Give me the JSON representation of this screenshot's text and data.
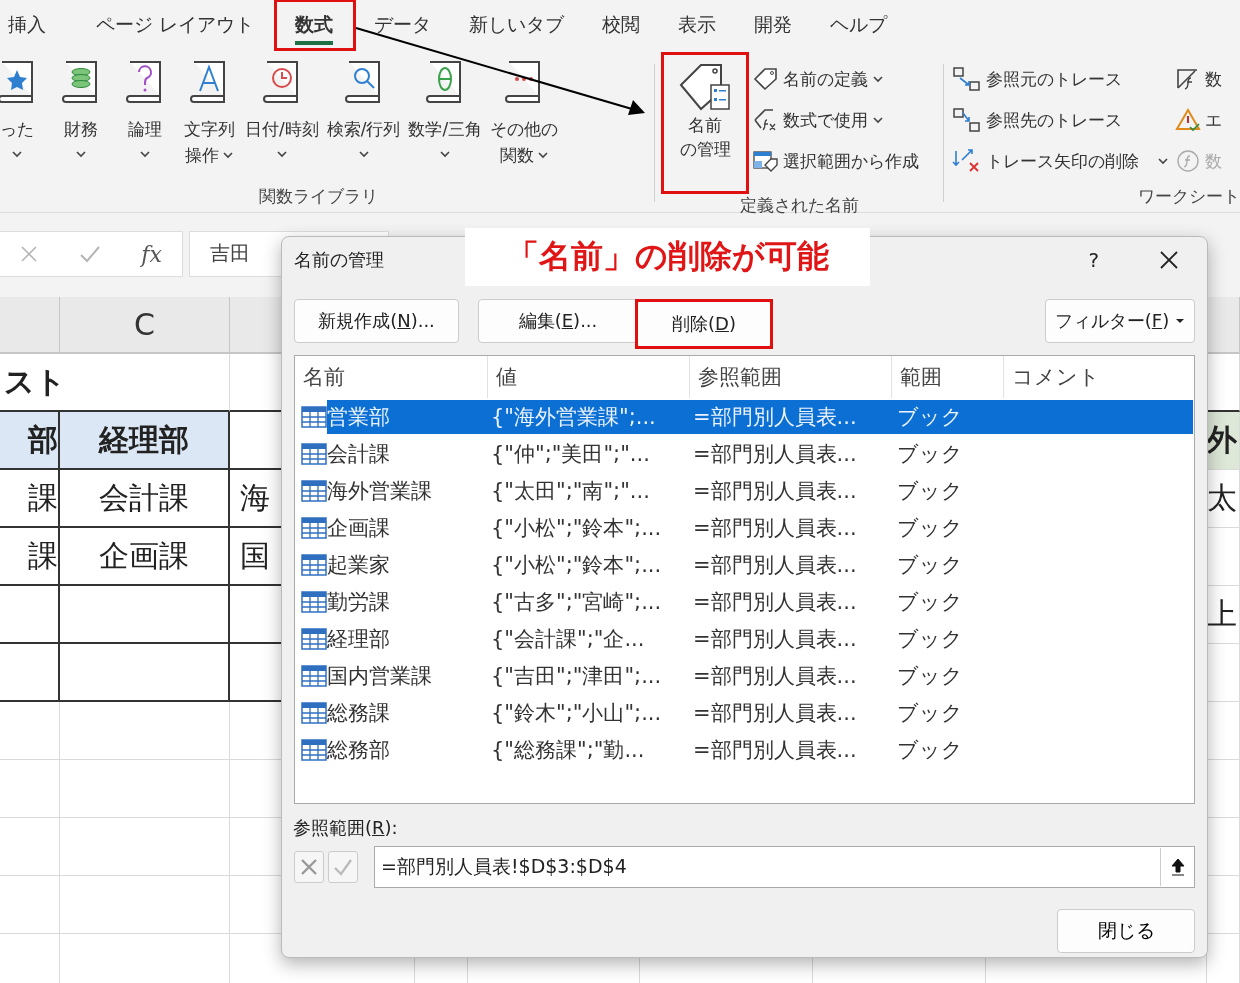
{
  "ribbon_tabs": [
    {
      "label": "挿入",
      "selected": false
    },
    {
      "label": "ページ レイアウト",
      "selected": false
    },
    {
      "label": "数式",
      "selected": true
    },
    {
      "label": "データ",
      "selected": false
    },
    {
      "label": "新しいタブ",
      "selected": false
    },
    {
      "label": "校閲",
      "selected": false
    },
    {
      "label": "表示",
      "selected": false
    },
    {
      "label": "開発",
      "selected": false
    },
    {
      "label": "ヘルプ",
      "selected": false
    }
  ],
  "function_library": {
    "group_label": "関数ライブラリ",
    "buttons": [
      {
        "kind": "recent",
        "lines": [
          "った"
        ]
      },
      {
        "kind": "finance",
        "lines": [
          "財務"
        ]
      },
      {
        "kind": "logic",
        "lines": [
          "論理"
        ]
      },
      {
        "kind": "text",
        "lines": [
          "文字列",
          "操作"
        ]
      },
      {
        "kind": "datetime",
        "lines": [
          "日付/時刻"
        ]
      },
      {
        "kind": "lookup",
        "lines": [
          "検索/行列"
        ]
      },
      {
        "kind": "math",
        "lines": [
          "数学/三角"
        ]
      },
      {
        "kind": "more",
        "lines": [
          "その他の",
          "関数"
        ]
      }
    ]
  },
  "defined_names": {
    "group_label": "定義された名前",
    "manager_lines": [
      "名前",
      "の管理"
    ],
    "commands": [
      {
        "kind": "define",
        "label": "名前の定義",
        "dropdown": true
      },
      {
        "kind": "use",
        "label": "数式で使用",
        "dropdown": true
      },
      {
        "kind": "create",
        "label": "選択範囲から作成",
        "dropdown": false
      }
    ]
  },
  "auditing": {
    "group_label": "ワークシート",
    "commands": [
      {
        "kind": "precedents",
        "label": "参照元のトレース",
        "dropdown": false
      },
      {
        "kind": "dependents",
        "label": "参照先のトレース",
        "dropdown": false
      },
      {
        "kind": "remove",
        "label": "トレース矢印の削除",
        "dropdown": true
      }
    ],
    "cut_commands": [
      {
        "kind": "show",
        "label": "数",
        "disabled": false
      },
      {
        "kind": "error",
        "label": "エ",
        "disabled": false
      },
      {
        "kind": "evaluate",
        "label": "数",
        "disabled": true
      }
    ]
  },
  "formula_bar": {
    "function_symbol": "fx",
    "value": "吉田"
  },
  "sheet": {
    "column_header": "C",
    "rows": [
      {
        "kind": "title",
        "a": "スト"
      },
      {
        "kind": "header",
        "a": "部",
        "c": "経理部",
        "e": "外"
      },
      {
        "kind": "data",
        "a": "課",
        "c": "会計課",
        "d": "海",
        "e": "太"
      },
      {
        "kind": "data",
        "a": "課",
        "c": "企画課",
        "d": "国"
      },
      {
        "kind": "data",
        "e": "上"
      },
      {
        "kind": "data"
      }
    ]
  },
  "dialog": {
    "title": "名前の管理",
    "help": "?",
    "buttons": [
      {
        "before": "新規作成(",
        "key": "N",
        "after": ")...",
        "dropdown": false
      },
      {
        "before": "編集(",
        "key": "E",
        "after": ")...",
        "dropdown": false
      },
      {
        "before": "削除(",
        "key": "D",
        "after": ")",
        "dropdown": false
      },
      {
        "before": "フィルター(",
        "key": "F",
        "after": ")",
        "dropdown": true
      }
    ],
    "columns": [
      "名前",
      "値",
      "参照範囲",
      "範囲",
      "コメント"
    ],
    "rows": [
      {
        "name": "営業部",
        "value": "{\"海外営業課\";...",
        "refers_to": "=部門別人員表...",
        "scope": "ブック",
        "selected": true
      },
      {
        "name": "会計課",
        "value": "{\"仲\";\"美田\";\"...",
        "refers_to": "=部門別人員表...",
        "scope": "ブック",
        "selected": false
      },
      {
        "name": "海外営業課",
        "value": "{\"太田\";\"南\";\"...",
        "refers_to": "=部門別人員表...",
        "scope": "ブック",
        "selected": false
      },
      {
        "name": "企画課",
        "value": "{\"小松\";\"鈴本\";...",
        "refers_to": "=部門別人員表...",
        "scope": "ブック",
        "selected": false
      },
      {
        "name": "起業家",
        "value": "{\"小松\";\"鈴本\";...",
        "refers_to": "=部門別人員表...",
        "scope": "ブック",
        "selected": false
      },
      {
        "name": "勤労課",
        "value": "{\"古多\";\"宮崎\";...",
        "refers_to": "=部門別人員表...",
        "scope": "ブック",
        "selected": false
      },
      {
        "name": "経理部",
        "value": "{\"会計課\";\"企...",
        "refers_to": "=部門別人員表...",
        "scope": "ブック",
        "selected": false
      },
      {
        "name": "国内営業課",
        "value": "{\"吉田\";\"津田\";...",
        "refers_to": "=部門別人員表...",
        "scope": "ブック",
        "selected": false
      },
      {
        "name": "総務課",
        "value": "{\"鈴木\";\"小山\";...",
        "refers_to": "=部門別人員表...",
        "scope": "ブック",
        "selected": false
      },
      {
        "name": "総務部",
        "value": "{\"総務課\";\"勤...",
        "refers_to": "=部門別人員表...",
        "scope": "ブック",
        "selected": false
      }
    ],
    "refers_label": {
      "before": "参照範囲(",
      "key": "R",
      "after": "):"
    },
    "refers_value": "=部門別人員表!$D$3:$D$4",
    "close": "閉じる"
  },
  "callout": "「名前」の削除が可能"
}
